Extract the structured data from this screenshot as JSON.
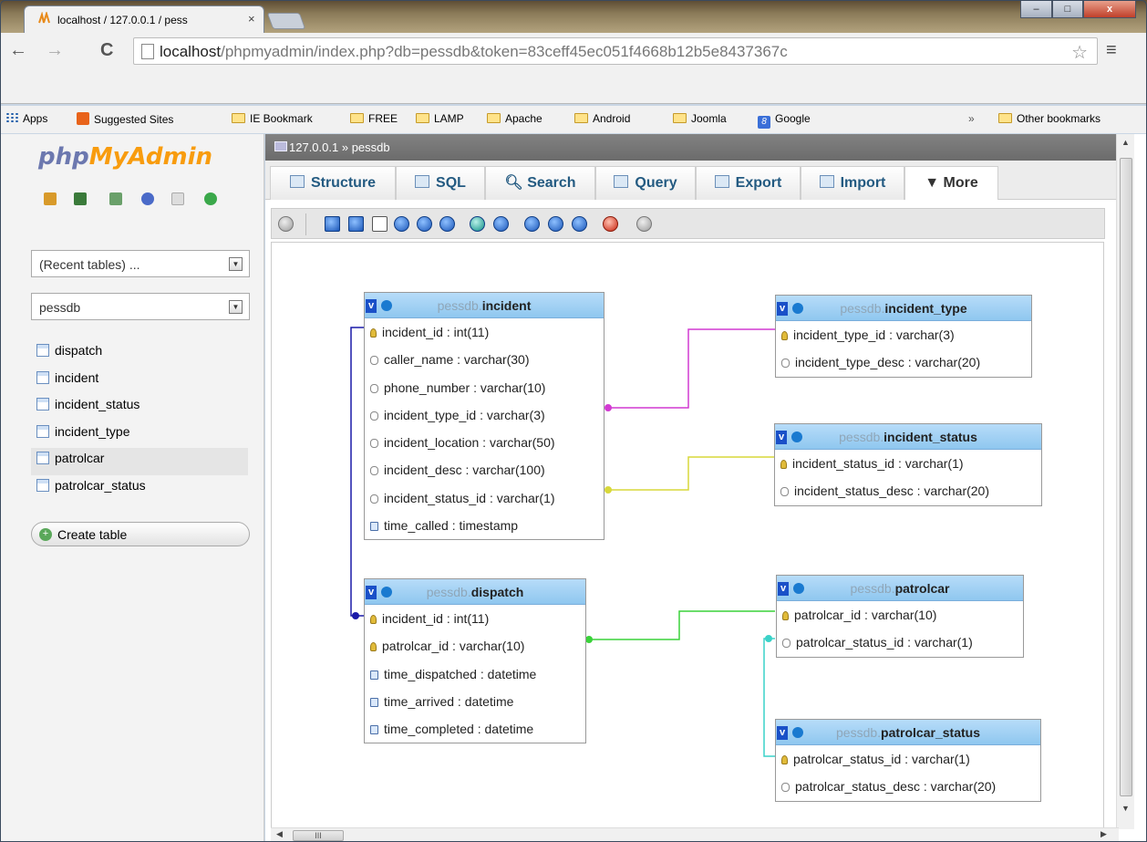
{
  "browser": {
    "tab_title": "localhost / 127.0.0.1 / pess",
    "tab_close": "×",
    "url_host": "localhost",
    "url_path": "/phpmyadmin/index.php?db=pessdb&token=83ceff45ec051f4668b12b5e8437367c",
    "window_buttons": {
      "minimize": "‒",
      "maximize": "□",
      "close": "x"
    },
    "bookmarks": [
      "Apps",
      "Suggested Sites",
      "IE Bookmark",
      "FREE",
      "LAMP",
      "Apache",
      "Android",
      "Joomla",
      "Google"
    ],
    "bookmarks_overflow": "»",
    "other_bookmarks": "Other bookmarks"
  },
  "sidebar": {
    "logo_php": "php",
    "logo_myadmin": "MyAdmin",
    "recent_tables": "(Recent tables) ...",
    "database": "pessdb",
    "tables": [
      "dispatch",
      "incident",
      "incident_status",
      "incident_type",
      "patrolcar",
      "patrolcar_status"
    ],
    "create_table": "Create table"
  },
  "breadcrumb": {
    "server": "127.0.0.1",
    "sep": "»",
    "db": "pessdb"
  },
  "tabs": [
    "Structure",
    "SQL",
    "Search",
    "Query",
    "Export",
    "Import",
    "More"
  ],
  "designer": {
    "tables": [
      {
        "db": "pessdb.",
        "name": "incident",
        "columns": [
          {
            "key": true,
            "text": "incident_id : int(11)"
          },
          {
            "text": "caller_name : varchar(30)"
          },
          {
            "text": "phone_number : varchar(10)"
          },
          {
            "text": "incident_type_id : varchar(3)"
          },
          {
            "text": "incident_location : varchar(50)"
          },
          {
            "text": "incident_desc : varchar(100)"
          },
          {
            "text": "incident_status_id : varchar(1)"
          },
          {
            "ts": true,
            "text": "time_called : timestamp"
          }
        ]
      },
      {
        "db": "pessdb.",
        "name": "incident_type",
        "columns": [
          {
            "key": true,
            "text": "incident_type_id : varchar(3)"
          },
          {
            "text": "incident_type_desc : varchar(20)"
          }
        ]
      },
      {
        "db": "pessdb.",
        "name": "incident_status",
        "columns": [
          {
            "key": true,
            "text": "incident_status_id : varchar(1)"
          },
          {
            "text": "incident_status_desc : varchar(20)"
          }
        ]
      },
      {
        "db": "pessdb.",
        "name": "dispatch",
        "columns": [
          {
            "key": true,
            "text": "incident_id : int(11)"
          },
          {
            "key": true,
            "text": "patrolcar_id : varchar(10)"
          },
          {
            "ts": true,
            "text": "time_dispatched : datetime"
          },
          {
            "ts": true,
            "text": "time_arrived : datetime"
          },
          {
            "ts": true,
            "text": "time_completed : datetime"
          }
        ]
      },
      {
        "db": "pessdb.",
        "name": "patrolcar",
        "columns": [
          {
            "key": true,
            "text": "patrolcar_id : varchar(10)"
          },
          {
            "text": "patrolcar_status_id : varchar(1)"
          }
        ]
      },
      {
        "db": "pessdb.",
        "name": "patrolcar_status",
        "columns": [
          {
            "key": true,
            "text": "patrolcar_status_id : varchar(1)"
          },
          {
            "text": "patrolcar_status_desc : varchar(20)"
          }
        ]
      }
    ],
    "relation_colors": {
      "incident_type": "#d23ad2",
      "incident_status": "#d8d83a",
      "dispatch_incident": "#1a1aa8",
      "dispatch_patrolcar": "#3ad23a",
      "patrolcar_status": "#3ad2c8"
    }
  }
}
